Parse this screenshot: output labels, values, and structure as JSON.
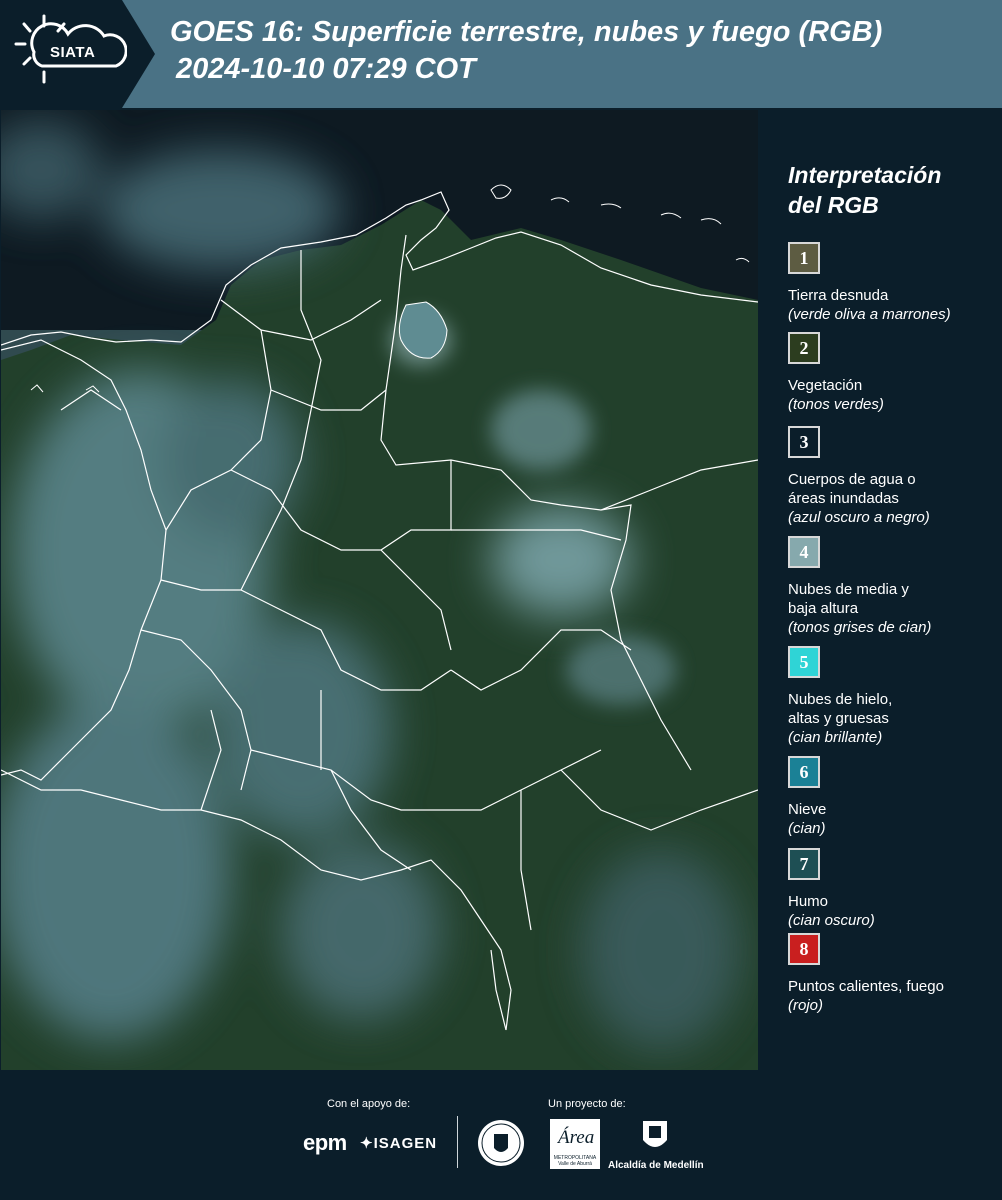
{
  "header": {
    "logo_text": "SIATA",
    "title_line1": "GOES 16: Superficie terrestre, nubes y fuego (RGB)",
    "title_line2": "2024-10-10 07:29 COT"
  },
  "map": {
    "region": "Colombia",
    "colors": {
      "ocean": "#0d1820",
      "land": "#22402a",
      "cloud": "#6f9ba3",
      "border": "#ffffff"
    }
  },
  "legend": {
    "title_line1": "Interpretación",
    "title_line2": "del RGB",
    "items": [
      {
        "num": "1",
        "label": "Tierra desnuda",
        "sub": "(verde oliva a marrones)",
        "color": "#5d5c42",
        "text_color": "#ffffff"
      },
      {
        "num": "2",
        "label": "Vegetación",
        "sub": "(tonos verdes)",
        "color": "#2c3d1f",
        "text_color": "#ffffff"
      },
      {
        "num": "3",
        "label": "Cuerpos de agua o\náreas inundadas",
        "sub": "(azul oscuro a negro)",
        "color": "#0b1e2a",
        "text_color": "#ffffff"
      },
      {
        "num": "4",
        "label": "Nubes de media y\nbaja altura",
        "sub": "(tonos grises de cian)",
        "color": "#86a9ad",
        "text_color": "#ffffff"
      },
      {
        "num": "5",
        "label": "Nubes de hielo,\naltas y gruesas",
        "sub": "(cian brillante)",
        "color": "#2fd4d6",
        "text_color": "#ffffff"
      },
      {
        "num": "6",
        "label": "Nieve",
        "sub": "(cian)",
        "color": "#1b8196",
        "text_color": "#ffffff"
      },
      {
        "num": "7",
        "label": "Humo",
        "sub": "(cian oscuro)",
        "color": "#1e4f54",
        "text_color": "#ffffff"
      },
      {
        "num": "8",
        "label": "Puntos calientes, fuego",
        "sub": "(rojo)",
        "color": "#c91f1f",
        "text_color": "#ffffff"
      }
    ]
  },
  "footer": {
    "support_label": "Con el apoyo de:",
    "project_label": "Un proyecto de:",
    "epm": "epm",
    "isagen": "ISAGEN",
    "area_script": "Área",
    "area_text": "METROPOLITANA Valle de Aburrá",
    "alcaldia": "Alcaldía de Medellín"
  }
}
